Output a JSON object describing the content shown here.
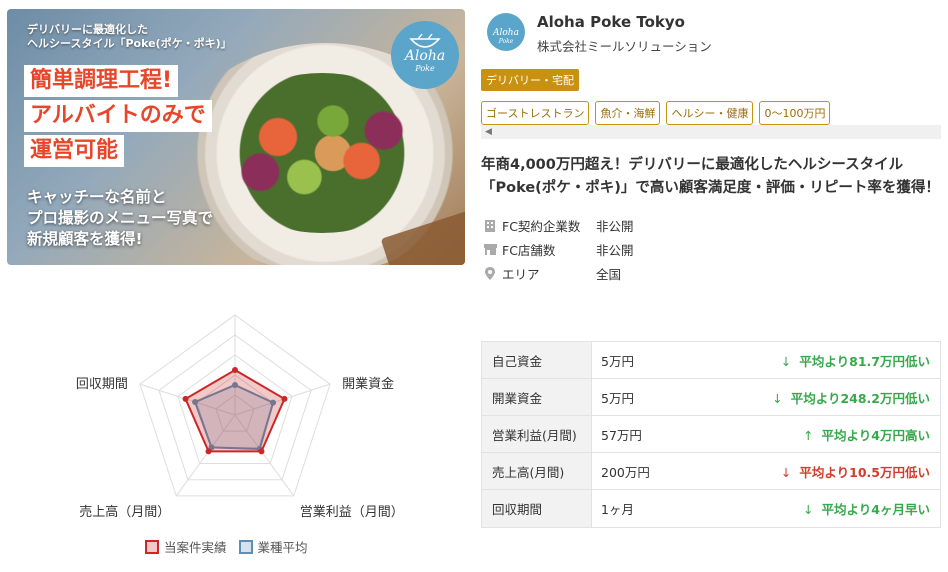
{
  "hero": {
    "top_note_line1": "デリバリーに最適化した",
    "top_note_line2": "ヘルシースタイル「Poke(ポケ・ポキ)」",
    "headline_lines": [
      "簡単調理工程!",
      "アルバイトのみで",
      "運営可能"
    ],
    "sub_lines": [
      "キャッチーな名前と",
      "プロ撮影のメニュー写真で",
      "新規顧客を獲得!"
    ],
    "logo_text": "Aloha",
    "logo_sub": "Poke"
  },
  "brand": {
    "logo_text": "Aloha",
    "logo_sub": "Poke",
    "name": "Aloha Poke Tokyo",
    "company": "株式会社ミールソリューション"
  },
  "main_tag": "デリバリー・宅配",
  "tags": [
    "ゴーストレストラン",
    "魚介・海鮮",
    "ヘルシー・健康",
    "0〜100万円"
  ],
  "headline": "年商4,000万円超え！デリバリーに最適化したヘルシースタイル「Poke(ポケ・ポキ)」で高い顧客満足度・評価・リピート率を獲得！",
  "facts": [
    {
      "icon": "building-icon",
      "label": "FC契約企業数",
      "value": "非公開"
    },
    {
      "icon": "store-icon",
      "label": "FC店舗数",
      "value": "非公開"
    },
    {
      "icon": "map-pin-icon",
      "label": "エリア",
      "value": "全国"
    }
  ],
  "chart_data": {
    "type": "radar",
    "axes": [
      "自己資金",
      "開業資金",
      "営業利益（月間）",
      "売上高（月間）",
      "回収期間"
    ],
    "series": [
      {
        "name": "当案件実績",
        "color": "#cc2727",
        "values": [
          0.45,
          0.52,
          0.45,
          0.45,
          0.52
        ]
      },
      {
        "name": "業種平均",
        "color": "#5b8fb3",
        "values": [
          0.3,
          0.4,
          0.42,
          0.4,
          0.42
        ]
      }
    ]
  },
  "legend": {
    "this": "当案件実績",
    "avg": "業種平均"
  },
  "metrics": [
    {
      "label": "自己資金",
      "value": "5万円",
      "arrow": "↓",
      "compare": "平均より81.7万円低い",
      "status": "good"
    },
    {
      "label": "開業資金",
      "value": "5万円",
      "arrow": "↓",
      "compare": "平均より248.2万円低い",
      "status": "good"
    },
    {
      "label": "営業利益(月間)",
      "value": "57万円",
      "arrow": "↑",
      "compare": "平均より4万円高い",
      "status": "good"
    },
    {
      "label": "売上高(月間)",
      "value": "200万円",
      "arrow": "↓",
      "compare": "平均より10.5万円低い",
      "status": "bad"
    },
    {
      "label": "回収期間",
      "value": "1ヶ月",
      "arrow": "↓",
      "compare": "平均より4ヶ月早い",
      "status": "good"
    }
  ]
}
